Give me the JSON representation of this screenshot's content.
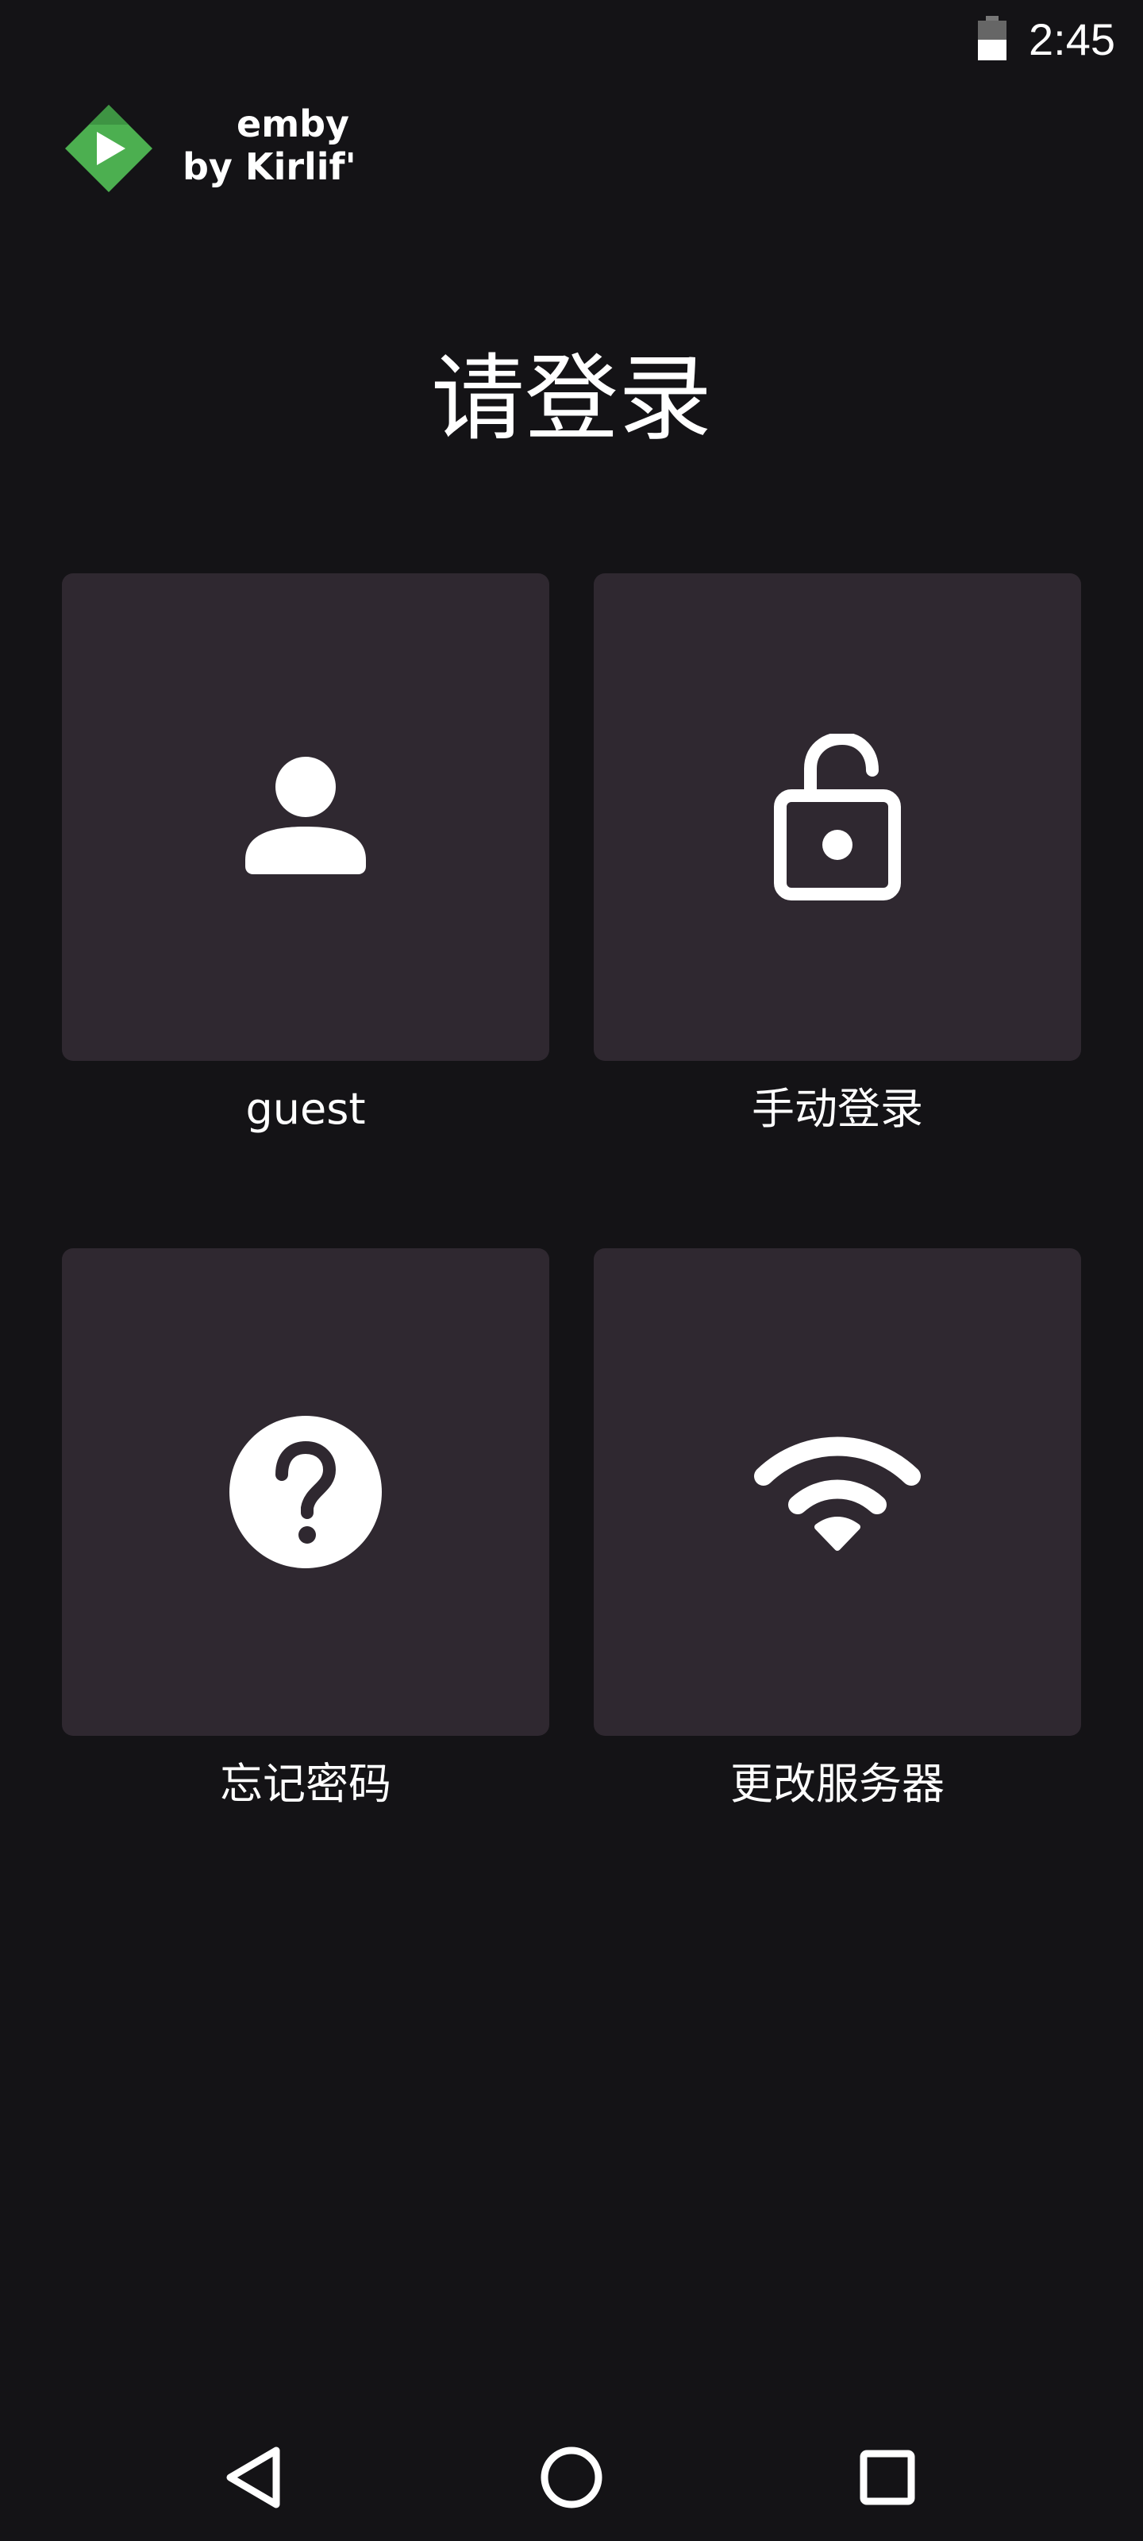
{
  "status_bar": {
    "time": "2:45",
    "battery_icon": "battery-icon"
  },
  "brand": {
    "name": "emby",
    "subtitle": "by Kirlif'",
    "logo_icon": "emby-logo-icon",
    "accent": "#4CAF50"
  },
  "page": {
    "title": "请登录"
  },
  "tiles": [
    {
      "label": "guest",
      "icon": "person-icon"
    },
    {
      "label": "手动登录",
      "icon": "unlock-icon"
    },
    {
      "label": "忘记密码",
      "icon": "help-circle-icon"
    },
    {
      "label": "更改服务器",
      "icon": "wifi-icon"
    }
  ],
  "nav": {
    "back_icon": "back-triangle-icon",
    "home_icon": "home-circle-icon",
    "recents_icon": "recents-square-icon"
  },
  "colors": {
    "background": "#141316",
    "tile": "#2f2830",
    "text": "#ffffff"
  }
}
